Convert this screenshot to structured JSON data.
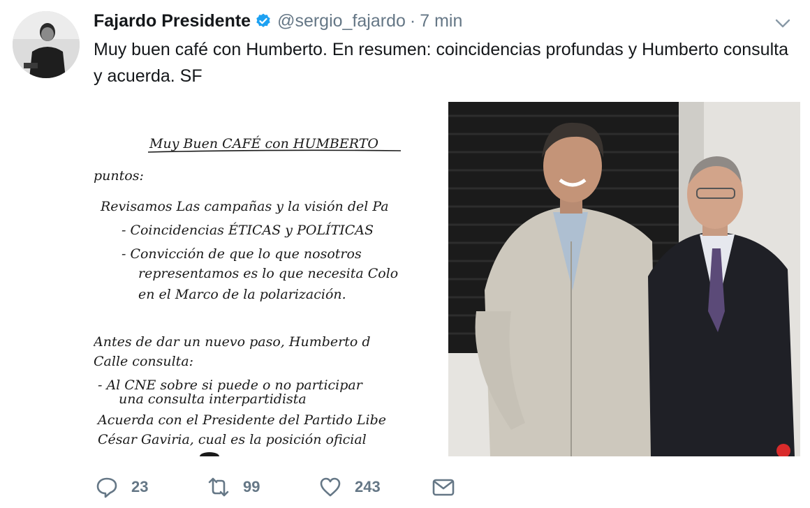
{
  "tweet": {
    "display_name": "Fajardo Presidente",
    "handle": "@sergio_fajardo",
    "separator": "·",
    "time": "7 min",
    "text": "Muy buen café con Humberto. En resumen: coincidencias profundas y Humberto consulta y acuerda. SF"
  },
  "actions": {
    "replies": "23",
    "retweets": "99",
    "likes": "243"
  },
  "note_lines": [
    "Muy Buen CAFÉ con HUMBERTO",
    "puntos:",
    "Revisamos Las campañas y la visión del Pa",
    "- Coincidencias ÉTICAS y POLÍTICAS",
    "- Convicción de que lo que nosotros",
    "representamos es lo que necesita Colo",
    "en el Marco de la polarización.",
    "Antes de dar un nuevo paso, Humberto d",
    "Calle consulta:",
    "- Al CNE sobre si puede o no participar",
    "una consulta interpartidista",
    "Acuerda con el Presidente del Partido Libe",
    "César Gaviria, cual es la posición oficial"
  ],
  "colors": {
    "text": "#14171a",
    "muted": "#657786",
    "verified": "#1da1f2",
    "ink": "#1a1a1a"
  },
  "icons": {
    "verified": "verified-badge-icon",
    "menu": "chevron-down-icon",
    "reply": "reply-icon",
    "retweet": "retweet-icon",
    "like": "heart-icon",
    "message": "direct-message-icon"
  }
}
